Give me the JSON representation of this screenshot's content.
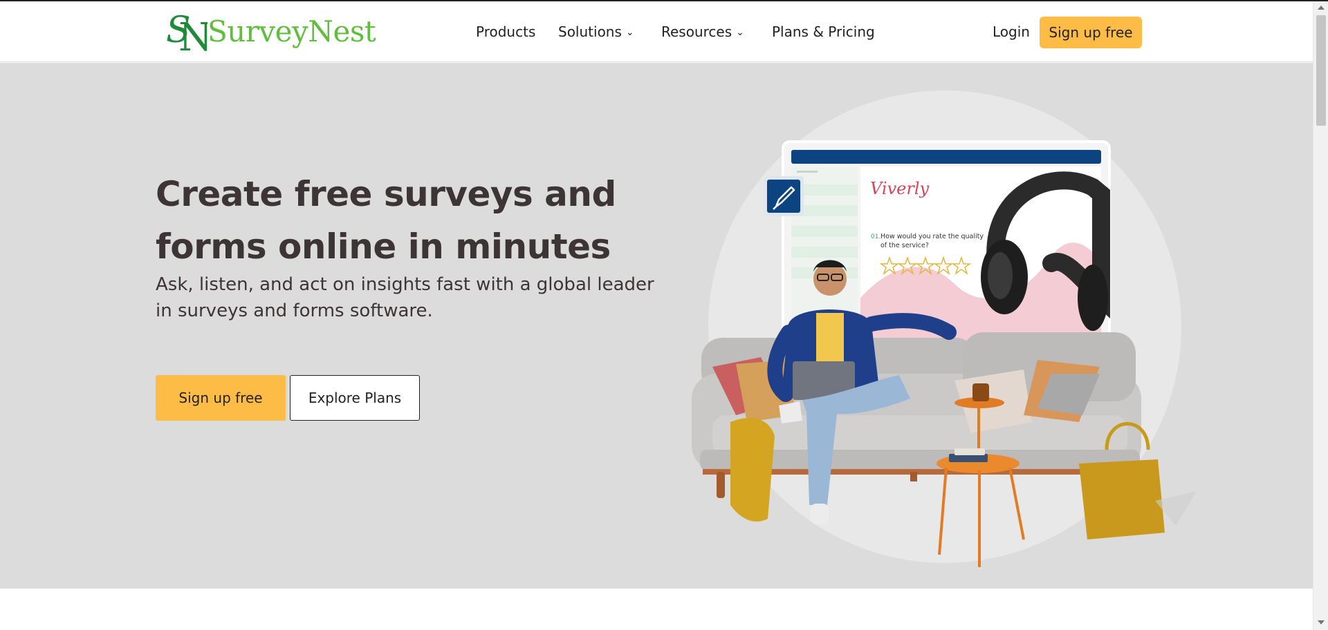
{
  "brand": {
    "name": "SurveyNest",
    "monogram": "SN",
    "color": "#5fbf3d",
    "monogram_color": "#1f8a3a"
  },
  "nav": {
    "items": [
      {
        "label": "Products",
        "has_dropdown": false
      },
      {
        "label": "Solutions",
        "has_dropdown": true
      },
      {
        "label": "Resources",
        "has_dropdown": true
      },
      {
        "label": "Plans & Pricing",
        "has_dropdown": false
      }
    ],
    "login_label": "Login",
    "signup_label": "Sign up free"
  },
  "hero": {
    "title": "Create free surveys and forms online in minutes",
    "subtitle": "Ask, listen, and act on insights fast with a global leader in surveys and forms software.",
    "primary_cta": "Sign up free",
    "secondary_cta": "Explore Plans",
    "illustration": {
      "survey_brand": "Viverly",
      "question_number": "01.",
      "question_text_line1": "How would you rate the quality",
      "question_text_line2": "of the service?",
      "rating_stars": 5,
      "icons": [
        "paintbrush-icon",
        "headphones-image",
        "person-on-sofa-image"
      ]
    }
  },
  "colors": {
    "accent": "#fcbc45",
    "hero_bg": "#dcdcdc",
    "heading": "#3d3535",
    "survey_header": "#0b4481"
  }
}
